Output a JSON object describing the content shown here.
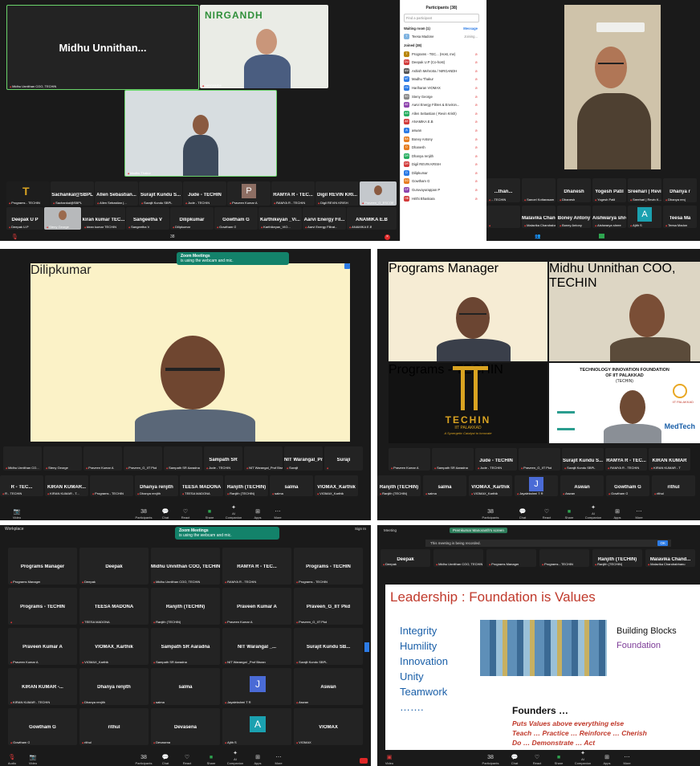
{
  "panel1": {
    "featured_name": "Midhu Unnithan...",
    "featured_caption": "Midhu Unnithan COO, TECHIN",
    "nirgandh_logo": "NIRGANDH",
    "nirgandh_caption": "NIRGANDH",
    "thakur_caption": "Madhu Thakur",
    "row1": [
      "Sachankal@SBPL",
      "Allen Sebastian...",
      "Surajit Kundu S...",
      "Jude - TECHIN",
      "",
      "RAMYA R - TEC...",
      "Digil REVIN KRI...",
      ""
    ],
    "row1_sub": [
      "Programs - TECHIN",
      "Sachankal@SBPL",
      "Allen Sebastian (...",
      "Surajit Kundu SBPL",
      "Jude - TECHIN",
      "Praveen Kumar A",
      "RAMYA R - TECHIN",
      "Digil REVIN KRISH",
      "Praveen_G_ESCOE"
    ],
    "p_letter": "P",
    "row2": [
      "Deepak U P",
      "",
      "kiran kumar TEC...",
      "Sangeetha V",
      "Dilipkumar",
      "Gowtham G",
      "Karthikeyan _Vi...",
      "Aarvi Energy Fil...",
      "ANAMIKA E.B"
    ],
    "row2_sub": [
      "Deepak U.P",
      "Steny George",
      "kiran kumar TECHIN",
      "Sangeetha V",
      "Dilipkumar",
      "Gowtham G",
      "Karthikeyan_VIO...",
      "Aarvi Energy Filtrat...",
      "ANAMIKA E.B"
    ],
    "participant_count": "38"
  },
  "participants_panel": {
    "title": "Participants (38)",
    "search": "Find a participant",
    "waiting_label": "Waiting room (1)",
    "message_label": "Message",
    "waiting_person": "Teesa Madone",
    "waiting_status": "Joining...",
    "joined_label": "Joined (38)",
    "people": [
      {
        "name": "Programs - TEC... (Host, me)",
        "color": "#b8860b",
        "initials": "T"
      },
      {
        "name": "Deepak U.P (Co-host)",
        "color": "#d23b3b",
        "initials": "DU"
      },
      {
        "name": "Ashish Mehrotra / NIRGANDH",
        "color": "#555555",
        "initials": "AM"
      },
      {
        "name": "Madhu Thakur",
        "color": "#2c7be5",
        "initials": "MT"
      },
      {
        "name": "Hariharan VIOMAX",
        "color": "#2c7be5",
        "initials": "HV"
      },
      {
        "name": "Steny George",
        "color": "#888888",
        "initials": "SG"
      },
      {
        "name": "Aarvi Energy Filtres & Environ...",
        "color": "#8e44ad",
        "initials": "AE"
      },
      {
        "name": "Allen Sebastian ( Revin Krish)",
        "color": "#27ae60",
        "initials": "AS"
      },
      {
        "name": "ANAMIKA E.B",
        "color": "#d23b3b",
        "initials": "AE"
      },
      {
        "name": "aswan",
        "color": "#2c7be5",
        "initials": "A"
      },
      {
        "name": "Boney Antony",
        "color": "#e67e22",
        "initials": "BA"
      },
      {
        "name": "Dhanesh",
        "color": "#e67e22",
        "initials": "D"
      },
      {
        "name": "Dhanya renjith",
        "color": "#27ae60",
        "initials": "DR"
      },
      {
        "name": "Digil REVIN KRISH",
        "color": "#d23b3b",
        "initials": "DR"
      },
      {
        "name": "Dilipkumar",
        "color": "#2c7be5",
        "initials": "D"
      },
      {
        "name": "Gowtham G",
        "color": "#e67e22",
        "initials": "GG"
      },
      {
        "name": "Guruvayurappan P",
        "color": "#8e44ad",
        "initials": "GP"
      },
      {
        "name": "Hrithi Bhaskara",
        "color": "#d23b3b",
        "initials": "HB"
      }
    ]
  },
  "panel2": {
    "strip": [
      "...than...",
      "",
      "Dhanesh",
      "Yogesh Patil",
      "Sreehari | Revin...",
      "Dhanya r"
    ],
    "strip_sub": [
      "...TECHIN",
      "Sanoel Kottarasam",
      "Dhanesh",
      "Yogesh Patil",
      "Sreehari | Revin K...",
      "Dhanya renj"
    ],
    "strip2": [
      "",
      "Malavika Chand...",
      "Boney Antony",
      "Aishwarya shree",
      "",
      "Teesa Ma"
    ],
    "strip2_sub": [
      "",
      "Malavika Chandraba...",
      "Boney Antony",
      "Aishwarya shree",
      "Ajith S",
      "Teesa Madon"
    ],
    "a_letter": "A"
  },
  "panel3": {
    "toast_title": "Zoom Meetings",
    "toast_body": "is using the webcam and mic.",
    "speaker_caption": "Dilipkumar",
    "strip": [
      "",
      "",
      "",
      "",
      "",
      "Sampath SR",
      "",
      "NIT Warangal_Pr...",
      "Suraji"
    ],
    "strip_sub": [
      "Midhu Unnithan CO...",
      "Steny George",
      "Praveen Kumar A",
      "Praveen_G_IIT Pkd",
      "Sampath SR Aaradna",
      "Jude - TECHIN",
      "NIT Warangal_Prof Bisran",
      "Surajit"
    ],
    "row2": [
      "R - TEC...",
      "KIRAN KUMAR...",
      "",
      "Dhanya renjith",
      "TEESA MADONA",
      "Ranjith (TECHIN)",
      "salma",
      "VIOMAX_Karthik"
    ],
    "row2_sub": [
      "R - TECHIN",
      "KIRAN KUMAR - T...",
      "Programs - TECHIN",
      "Dhanya renjith",
      "TEESA MADONA",
      "Ranjith (TECHIN)",
      "salma",
      "VIOMAX_Karthik",
      "Jayalekshmi"
    ],
    "count": "38"
  },
  "panel4": {
    "caption_a": "Programs Manager",
    "caption_b": "Midhu Unnithan COO, TECHIN",
    "techin_word": "TECHIN",
    "techin_sub": "IIT PALAKKAD",
    "techin_tagline": "A Synergetic Catalyst to Innovate",
    "techin_caption": "Programs - TECHIN",
    "foundation_line1": "TECHNOLOGY INNOVATION FOUNDATION",
    "foundation_line2": "OF IIT PALAKKAD",
    "foundation_line3": "(TECHIN)",
    "iit_palakkad": "IIT PALAKKAD",
    "medtech": "MedTech",
    "strip": [
      "",
      "",
      "Jude - TECHIN",
      "",
      "Surajit Kundu S...",
      "RAMYA R - TEC...",
      "KIRAN KUMAR"
    ],
    "strip_sub": [
      "Praveen Kumar A",
      "Sampath SR Aaradna",
      "Jude - TECHIN",
      "Praveen_G_IIT Pkd",
      "Surajit Kundu SBPL",
      "RAMYA R - TECHIN",
      "KIRAN KUMAR - T"
    ],
    "row2": [
      "Ranjith (TECHIN)",
      "salma",
      "VIOMAX_Karthik",
      "",
      "Aswan",
      "Gowtham G",
      "rithul"
    ],
    "row2_sub": [
      "Ranjith (TECHIN)",
      "salma",
      "VIOMAX_Karthik",
      "Jayalekshmi T R",
      "Aswan",
      "Gowtham G",
      "rithul"
    ],
    "j_letter": "J",
    "count": "38"
  },
  "panel5": {
    "title": "Workplace",
    "sign_in": "Sign In",
    "toast_title": "Zoom Meetings",
    "toast_body": "is using the webcam and mic.",
    "grid": [
      [
        "Programs Manager",
        "Deepak",
        "Midhu Unnithan COO, TECHIN",
        "RAMYA R - TEC...",
        "Programs - TECHIN"
      ],
      [
        "Programs - TECHIN",
        "TEESA MADONA",
        "Ranjith (TECHIN)",
        "Praveen Kumar A",
        "Praveen_G_IIT Pkd"
      ],
      [
        "Praveen Kumar A",
        "VIOMAX_Karthik",
        "Sampath SR Aaradna",
        "NIT Warangal _...",
        "Surajit Kundu SB..."
      ],
      [
        "KIRAN KUMAR -...",
        "Dhanya renjith",
        "salma",
        "",
        "Aswan"
      ],
      [
        "Gowtham G",
        "rithul",
        "Devasena",
        "",
        "VIOMAX"
      ]
    ],
    "grid_sub": [
      [
        "Programs Manager",
        "Deepak",
        "Midhu Unnithan COO, TECHIN",
        "RAMYA R - TECHIN",
        "Programs - TECHIN"
      ],
      [
        "",
        "TEESA MADONA",
        "Ranjith (TECHIN)",
        "Praveen Kumar A",
        "Praveen_G_IIT Pkd"
      ],
      [
        "Praveen Kumar A",
        "VIOMAX_Karthik",
        "Sampath SR Aaradna",
        "NIT Warangal _Prof Bisran",
        "Surajit Kundu SBPL"
      ],
      [
        "KIRAN KUMAR - TECHIN",
        "Dhanya renjith",
        "salma",
        "Jayalekshmi T R",
        "Aswan"
      ],
      [
        "Gowtham G",
        "rithul",
        "Devasena",
        "Ajith S",
        "VIOMAX"
      ]
    ],
    "j_letter": "J",
    "a_letter": "A",
    "count": "38"
  },
  "panel6": {
    "meeting_label": "Meeting",
    "share_label": "Premkumar Manoranth's screen",
    "recording_text": "This meeting is being recorded.",
    "ok": "OK",
    "strip": [
      "Deepak",
      "",
      "",
      "",
      "Ranjith (TECHIN)",
      "Malavika Chand..."
    ],
    "strip_sub": [
      "Deepak",
      "Midhu Unnithan COO, TECHIN",
      "Programs Manager",
      "Programs - TECHIN",
      "Ranjith (TECHIN)",
      "Malavika Chandrabhanu"
    ],
    "slide_title": "Leadership : Foundation is Values",
    "values": [
      "Integrity",
      "Humility",
      "Innovation",
      "Unity",
      "Teamwork",
      "……."
    ],
    "building_blocks": "Building Blocks",
    "foundation": "Foundation",
    "founders": "Founders …",
    "line1": "Puts Values above everything else",
    "line2": "Teach … Practice … Reinforce … Cherish",
    "line3": "Do … Demonstrate … Act",
    "count": "38"
  },
  "toolbar": {
    "participants": "Participants",
    "chat": "Chat",
    "react": "React",
    "share": "Share",
    "ai": "AI Companion",
    "apps": "Apps",
    "more": "More",
    "video": "Video",
    "audio": "Audio"
  }
}
